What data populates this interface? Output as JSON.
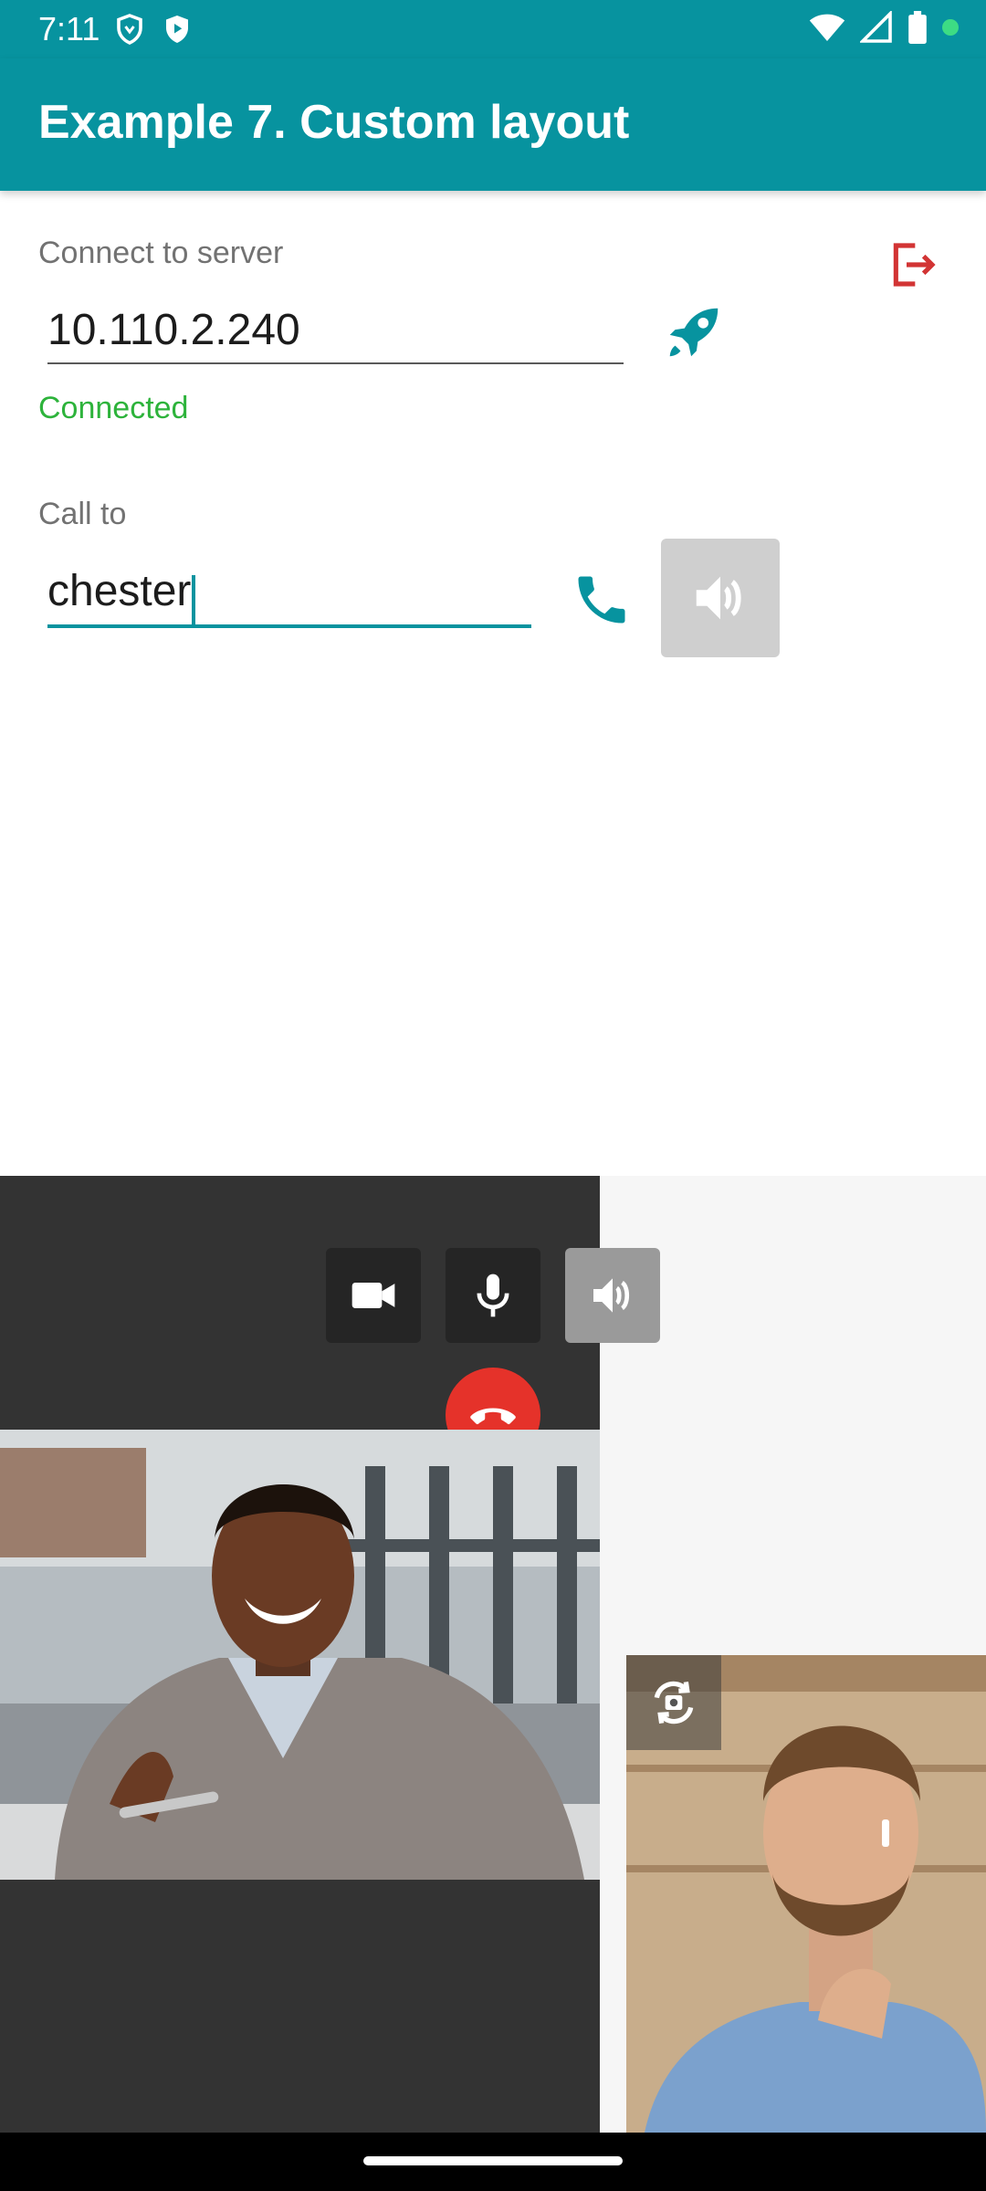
{
  "status_bar": {
    "time": "7:11",
    "left_icons": [
      "shield-icon",
      "play-protect-icon"
    ],
    "right_icons": [
      "wifi-icon",
      "signal-icon",
      "battery-icon",
      "green-dot-icon"
    ]
  },
  "app_bar": {
    "title": "Example 7. Custom layout"
  },
  "server": {
    "label": "Connect to server",
    "value": "10.110.2.240",
    "status": "Connected",
    "connect_icon": "rocket-icon",
    "logout_icon": "logout-icon"
  },
  "call": {
    "label": "Call to",
    "value": "chester",
    "call_icon": "phone-icon",
    "speaker_icon": "speaker-icon"
  },
  "call_controls": {
    "video_icon": "video-camera-icon",
    "mic_icon": "microphone-icon",
    "speaker_icon": "speaker-icon",
    "hangup_icon": "hangup-icon",
    "switch_camera_icon": "switch-camera-icon"
  },
  "colors": {
    "primary": "#07939f",
    "connected": "#2db33b",
    "hangup": "#e5322a",
    "logout": "#d23434",
    "call_bg": "#333333"
  }
}
